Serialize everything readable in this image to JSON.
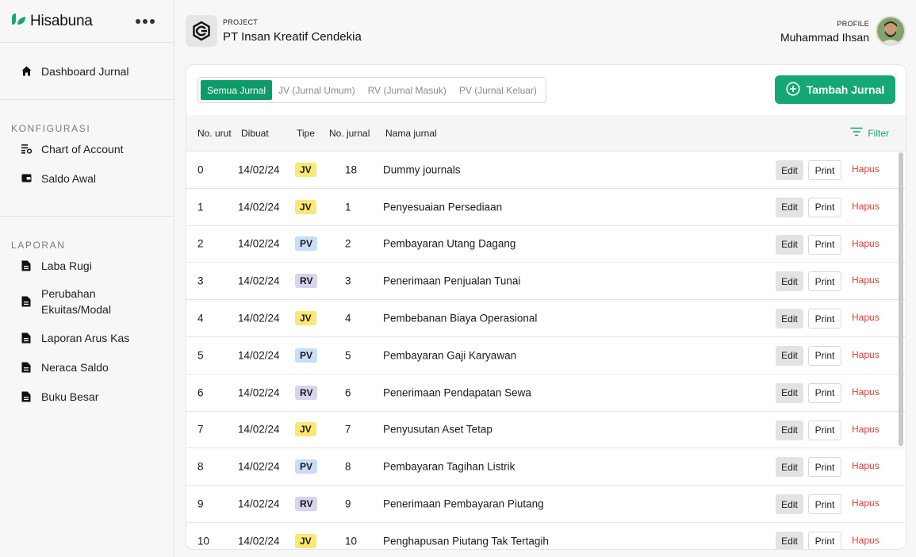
{
  "app": {
    "name": "Hisabuna",
    "colors": {
      "brand": "#16a874",
      "danger": "#e53935",
      "jv": "#fbe774",
      "pv": "#c8def8",
      "rv": "#d9d3f0"
    }
  },
  "sidebar": {
    "dashboard": {
      "label": "Dashboard Jurnal",
      "icon": "home-icon"
    },
    "konfigurasi": {
      "title": "KONFIGURASI",
      "items": [
        {
          "label": "Chart of Account",
          "icon": "list-settings-icon"
        },
        {
          "label": "Saldo Awal",
          "icon": "wallet-icon"
        }
      ]
    },
    "laporan": {
      "title": "LAPORAN",
      "items": [
        {
          "label": "Laba Rugi",
          "icon": "document-icon"
        },
        {
          "label": "Perubahan Ekuitas/Modal",
          "icon": "document-icon"
        },
        {
          "label": "Laporan Arus Kas",
          "icon": "document-icon"
        },
        {
          "label": "Neraca Saldo",
          "icon": "document-icon"
        },
        {
          "label": "Buku Besar",
          "icon": "document-icon"
        }
      ]
    }
  },
  "header": {
    "project_label": "PROJECT",
    "project_name": "PT Insan Kreatif Cendekia",
    "profile_label": "PROFILE",
    "profile_name": "Muhammad Ihsan"
  },
  "toolbar": {
    "tabs": [
      "Semua Jurnal",
      "JV (Jurnal Umum)",
      "RV (Jurnal Masuk)",
      "PV (Jurnal Keluar)"
    ],
    "active_tab": "Semua Jurnal",
    "add_label": "Tambah Jurnal"
  },
  "table": {
    "headers": {
      "no_urut": "No. urut",
      "dibuat": "Dibuat",
      "tipe": "Tipe",
      "no_jurnal": "No. jurnal",
      "nama": "Nama jurnal"
    },
    "filter_label": "Filter",
    "action_labels": {
      "edit": "Edit",
      "print": "Print",
      "hapus": "Hapus"
    },
    "rows": [
      {
        "no": "0",
        "date": "14/02/24",
        "type": "JV",
        "jno": "18",
        "name": "Dummy journals"
      },
      {
        "no": "1",
        "date": "14/02/24",
        "type": "JV",
        "jno": "1",
        "name": "Penyesuaian Persediaan"
      },
      {
        "no": "2",
        "date": "14/02/24",
        "type": "PV",
        "jno": "2",
        "name": "Pembayaran Utang Dagang"
      },
      {
        "no": "3",
        "date": "14/02/24",
        "type": "RV",
        "jno": "3",
        "name": "Penerimaan Penjualan Tunai"
      },
      {
        "no": "4",
        "date": "14/02/24",
        "type": "JV",
        "jno": "4",
        "name": "Pembebanan Biaya Operasional"
      },
      {
        "no": "5",
        "date": "14/02/24",
        "type": "PV",
        "jno": "5",
        "name": "Pembayaran Gaji Karyawan"
      },
      {
        "no": "6",
        "date": "14/02/24",
        "type": "RV",
        "jno": "6",
        "name": "Penerimaan Pendapatan Sewa"
      },
      {
        "no": "7",
        "date": "14/02/24",
        "type": "JV",
        "jno": "7",
        "name": "Penyusutan Aset Tetap"
      },
      {
        "no": "8",
        "date": "14/02/24",
        "type": "PV",
        "jno": "8",
        "name": "Pembayaran Tagihan Listrik"
      },
      {
        "no": "9",
        "date": "14/02/24",
        "type": "RV",
        "jno": "9",
        "name": "Penerimaan Pembayaran Piutang"
      },
      {
        "no": "10",
        "date": "14/02/24",
        "type": "JV",
        "jno": "10",
        "name": "Penghapusan Piutang Tak Tertagih"
      }
    ]
  }
}
